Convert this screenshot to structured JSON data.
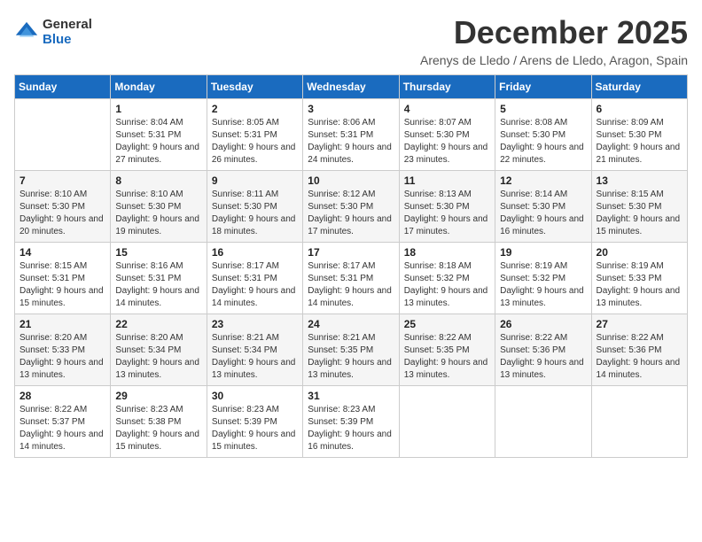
{
  "logo": {
    "general": "General",
    "blue": "Blue"
  },
  "title": "December 2025",
  "location": "Arenys de Lledo / Arens de Lledo, Aragon, Spain",
  "days_of_week": [
    "Sunday",
    "Monday",
    "Tuesday",
    "Wednesday",
    "Thursday",
    "Friday",
    "Saturday"
  ],
  "weeks": [
    [
      {
        "day": "",
        "sunrise": "",
        "sunset": "",
        "daylight": ""
      },
      {
        "day": "1",
        "sunrise": "Sunrise: 8:04 AM",
        "sunset": "Sunset: 5:31 PM",
        "daylight": "Daylight: 9 hours and 27 minutes."
      },
      {
        "day": "2",
        "sunrise": "Sunrise: 8:05 AM",
        "sunset": "Sunset: 5:31 PM",
        "daylight": "Daylight: 9 hours and 26 minutes."
      },
      {
        "day": "3",
        "sunrise": "Sunrise: 8:06 AM",
        "sunset": "Sunset: 5:31 PM",
        "daylight": "Daylight: 9 hours and 24 minutes."
      },
      {
        "day": "4",
        "sunrise": "Sunrise: 8:07 AM",
        "sunset": "Sunset: 5:30 PM",
        "daylight": "Daylight: 9 hours and 23 minutes."
      },
      {
        "day": "5",
        "sunrise": "Sunrise: 8:08 AM",
        "sunset": "Sunset: 5:30 PM",
        "daylight": "Daylight: 9 hours and 22 minutes."
      },
      {
        "day": "6",
        "sunrise": "Sunrise: 8:09 AM",
        "sunset": "Sunset: 5:30 PM",
        "daylight": "Daylight: 9 hours and 21 minutes."
      }
    ],
    [
      {
        "day": "7",
        "sunrise": "Sunrise: 8:10 AM",
        "sunset": "Sunset: 5:30 PM",
        "daylight": "Daylight: 9 hours and 20 minutes."
      },
      {
        "day": "8",
        "sunrise": "Sunrise: 8:10 AM",
        "sunset": "Sunset: 5:30 PM",
        "daylight": "Daylight: 9 hours and 19 minutes."
      },
      {
        "day": "9",
        "sunrise": "Sunrise: 8:11 AM",
        "sunset": "Sunset: 5:30 PM",
        "daylight": "Daylight: 9 hours and 18 minutes."
      },
      {
        "day": "10",
        "sunrise": "Sunrise: 8:12 AM",
        "sunset": "Sunset: 5:30 PM",
        "daylight": "Daylight: 9 hours and 17 minutes."
      },
      {
        "day": "11",
        "sunrise": "Sunrise: 8:13 AM",
        "sunset": "Sunset: 5:30 PM",
        "daylight": "Daylight: 9 hours and 17 minutes."
      },
      {
        "day": "12",
        "sunrise": "Sunrise: 8:14 AM",
        "sunset": "Sunset: 5:30 PM",
        "daylight": "Daylight: 9 hours and 16 minutes."
      },
      {
        "day": "13",
        "sunrise": "Sunrise: 8:15 AM",
        "sunset": "Sunset: 5:30 PM",
        "daylight": "Daylight: 9 hours and 15 minutes."
      }
    ],
    [
      {
        "day": "14",
        "sunrise": "Sunrise: 8:15 AM",
        "sunset": "Sunset: 5:31 PM",
        "daylight": "Daylight: 9 hours and 15 minutes."
      },
      {
        "day": "15",
        "sunrise": "Sunrise: 8:16 AM",
        "sunset": "Sunset: 5:31 PM",
        "daylight": "Daylight: 9 hours and 14 minutes."
      },
      {
        "day": "16",
        "sunrise": "Sunrise: 8:17 AM",
        "sunset": "Sunset: 5:31 PM",
        "daylight": "Daylight: 9 hours and 14 minutes."
      },
      {
        "day": "17",
        "sunrise": "Sunrise: 8:17 AM",
        "sunset": "Sunset: 5:31 PM",
        "daylight": "Daylight: 9 hours and 14 minutes."
      },
      {
        "day": "18",
        "sunrise": "Sunrise: 8:18 AM",
        "sunset": "Sunset: 5:32 PM",
        "daylight": "Daylight: 9 hours and 13 minutes."
      },
      {
        "day": "19",
        "sunrise": "Sunrise: 8:19 AM",
        "sunset": "Sunset: 5:32 PM",
        "daylight": "Daylight: 9 hours and 13 minutes."
      },
      {
        "day": "20",
        "sunrise": "Sunrise: 8:19 AM",
        "sunset": "Sunset: 5:33 PM",
        "daylight": "Daylight: 9 hours and 13 minutes."
      }
    ],
    [
      {
        "day": "21",
        "sunrise": "Sunrise: 8:20 AM",
        "sunset": "Sunset: 5:33 PM",
        "daylight": "Daylight: 9 hours and 13 minutes."
      },
      {
        "day": "22",
        "sunrise": "Sunrise: 8:20 AM",
        "sunset": "Sunset: 5:34 PM",
        "daylight": "Daylight: 9 hours and 13 minutes."
      },
      {
        "day": "23",
        "sunrise": "Sunrise: 8:21 AM",
        "sunset": "Sunset: 5:34 PM",
        "daylight": "Daylight: 9 hours and 13 minutes."
      },
      {
        "day": "24",
        "sunrise": "Sunrise: 8:21 AM",
        "sunset": "Sunset: 5:35 PM",
        "daylight": "Daylight: 9 hours and 13 minutes."
      },
      {
        "day": "25",
        "sunrise": "Sunrise: 8:22 AM",
        "sunset": "Sunset: 5:35 PM",
        "daylight": "Daylight: 9 hours and 13 minutes."
      },
      {
        "day": "26",
        "sunrise": "Sunrise: 8:22 AM",
        "sunset": "Sunset: 5:36 PM",
        "daylight": "Daylight: 9 hours and 13 minutes."
      },
      {
        "day": "27",
        "sunrise": "Sunrise: 8:22 AM",
        "sunset": "Sunset: 5:36 PM",
        "daylight": "Daylight: 9 hours and 14 minutes."
      }
    ],
    [
      {
        "day": "28",
        "sunrise": "Sunrise: 8:22 AM",
        "sunset": "Sunset: 5:37 PM",
        "daylight": "Daylight: 9 hours and 14 minutes."
      },
      {
        "day": "29",
        "sunrise": "Sunrise: 8:23 AM",
        "sunset": "Sunset: 5:38 PM",
        "daylight": "Daylight: 9 hours and 15 minutes."
      },
      {
        "day": "30",
        "sunrise": "Sunrise: 8:23 AM",
        "sunset": "Sunset: 5:39 PM",
        "daylight": "Daylight: 9 hours and 15 minutes."
      },
      {
        "day": "31",
        "sunrise": "Sunrise: 8:23 AM",
        "sunset": "Sunset: 5:39 PM",
        "daylight": "Daylight: 9 hours and 16 minutes."
      },
      {
        "day": "",
        "sunrise": "",
        "sunset": "",
        "daylight": ""
      },
      {
        "day": "",
        "sunrise": "",
        "sunset": "",
        "daylight": ""
      },
      {
        "day": "",
        "sunrise": "",
        "sunset": "",
        "daylight": ""
      }
    ]
  ]
}
